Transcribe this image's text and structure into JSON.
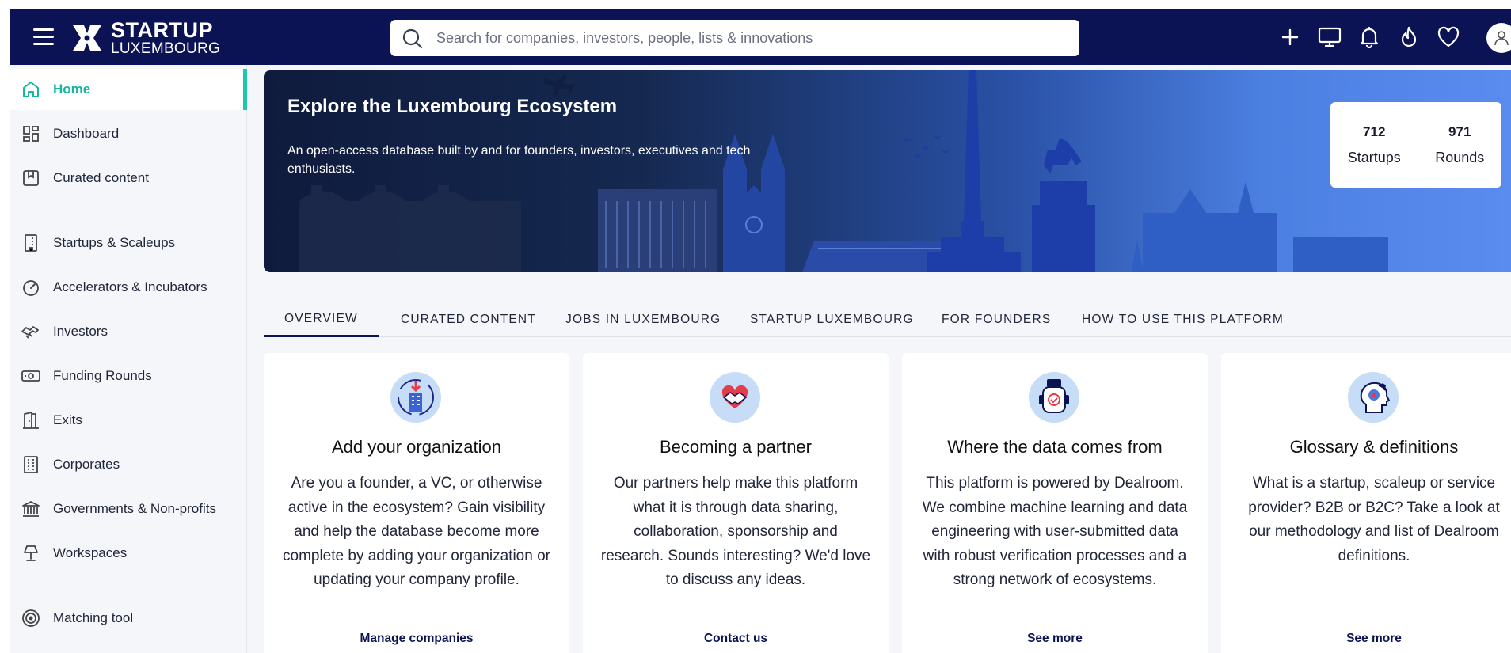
{
  "header": {
    "logo_line1": "STARTUP",
    "logo_line2": "LUXEMBOURG",
    "search_placeholder": "Search for companies, investors, people, lists & innovations",
    "icons": [
      "menu-icon",
      "plus-icon",
      "monitor-icon",
      "bell-icon",
      "flame-icon",
      "heart-icon",
      "user-icon"
    ]
  },
  "sidebar": {
    "items": [
      {
        "label": "Home",
        "icon": "home-icon",
        "active": true
      },
      {
        "label": "Dashboard",
        "icon": "dashboard-icon"
      },
      {
        "label": "Curated content",
        "icon": "bookmark-icon"
      },
      {
        "label": "Startups & Scaleups",
        "icon": "building-icon"
      },
      {
        "label": "Accelerators & Incubators",
        "icon": "speedometer-icon"
      },
      {
        "label": "Investors",
        "icon": "handshake-icon"
      },
      {
        "label": "Funding Rounds",
        "icon": "money-icon"
      },
      {
        "label": "Exits",
        "icon": "door-icon"
      },
      {
        "label": "Corporates",
        "icon": "office-icon"
      },
      {
        "label": "Governments & Non-profits",
        "icon": "bank-icon"
      },
      {
        "label": "Workspaces",
        "icon": "lamp-icon"
      },
      {
        "label": "Matching tool",
        "icon": "target-icon"
      }
    ]
  },
  "hero": {
    "title": "Explore the Luxembourg Ecosystem",
    "subtitle": "An open-access database built by and for founders, investors, executives and tech enthusiasts.",
    "stats": [
      {
        "value": "712",
        "label": "Startups"
      },
      {
        "value": "971",
        "label": "Rounds"
      }
    ]
  },
  "tabs": [
    "OVERVIEW",
    "CURATED CONTENT",
    "JOBS IN LUXEMBOURG",
    "STARTUP LUXEMBOURG",
    "FOR FOUNDERS",
    "HOW TO USE THIS PLATFORM"
  ],
  "cards": [
    {
      "title": "Add your organization",
      "body": "Are you a founder, a VC, or otherwise active in the ecosystem? Gain visibility and help the database become more complete by adding your organization or updating your company profile.",
      "link": "Manage companies",
      "icon": "building-add-icon"
    },
    {
      "title": "Becoming a partner",
      "body": "Our partners help make this platform what it is through data sharing, collaboration, sponsorship and research. Sounds interesting? We'd love to discuss any ideas.",
      "link": "Contact us",
      "icon": "handshake-heart-icon"
    },
    {
      "title": "Where the data comes from",
      "body": "This platform is powered by Dealroom. We combine machine learning and data engineering with user-submitted data with robust verification processes and a strong network of ecosystems.",
      "link": "See more",
      "icon": "robot-icon"
    },
    {
      "title": "Glossary & definitions",
      "body": "What is a startup, scaleup or service provider? B2B or B2C? Take a look at our methodology and list of Dealroom definitions.",
      "link": "See more",
      "icon": "head-idea-icon"
    }
  ],
  "colors": {
    "navy": "#0b1354",
    "accent": "#13b89e",
    "page_bg": "#f4f6f9"
  }
}
